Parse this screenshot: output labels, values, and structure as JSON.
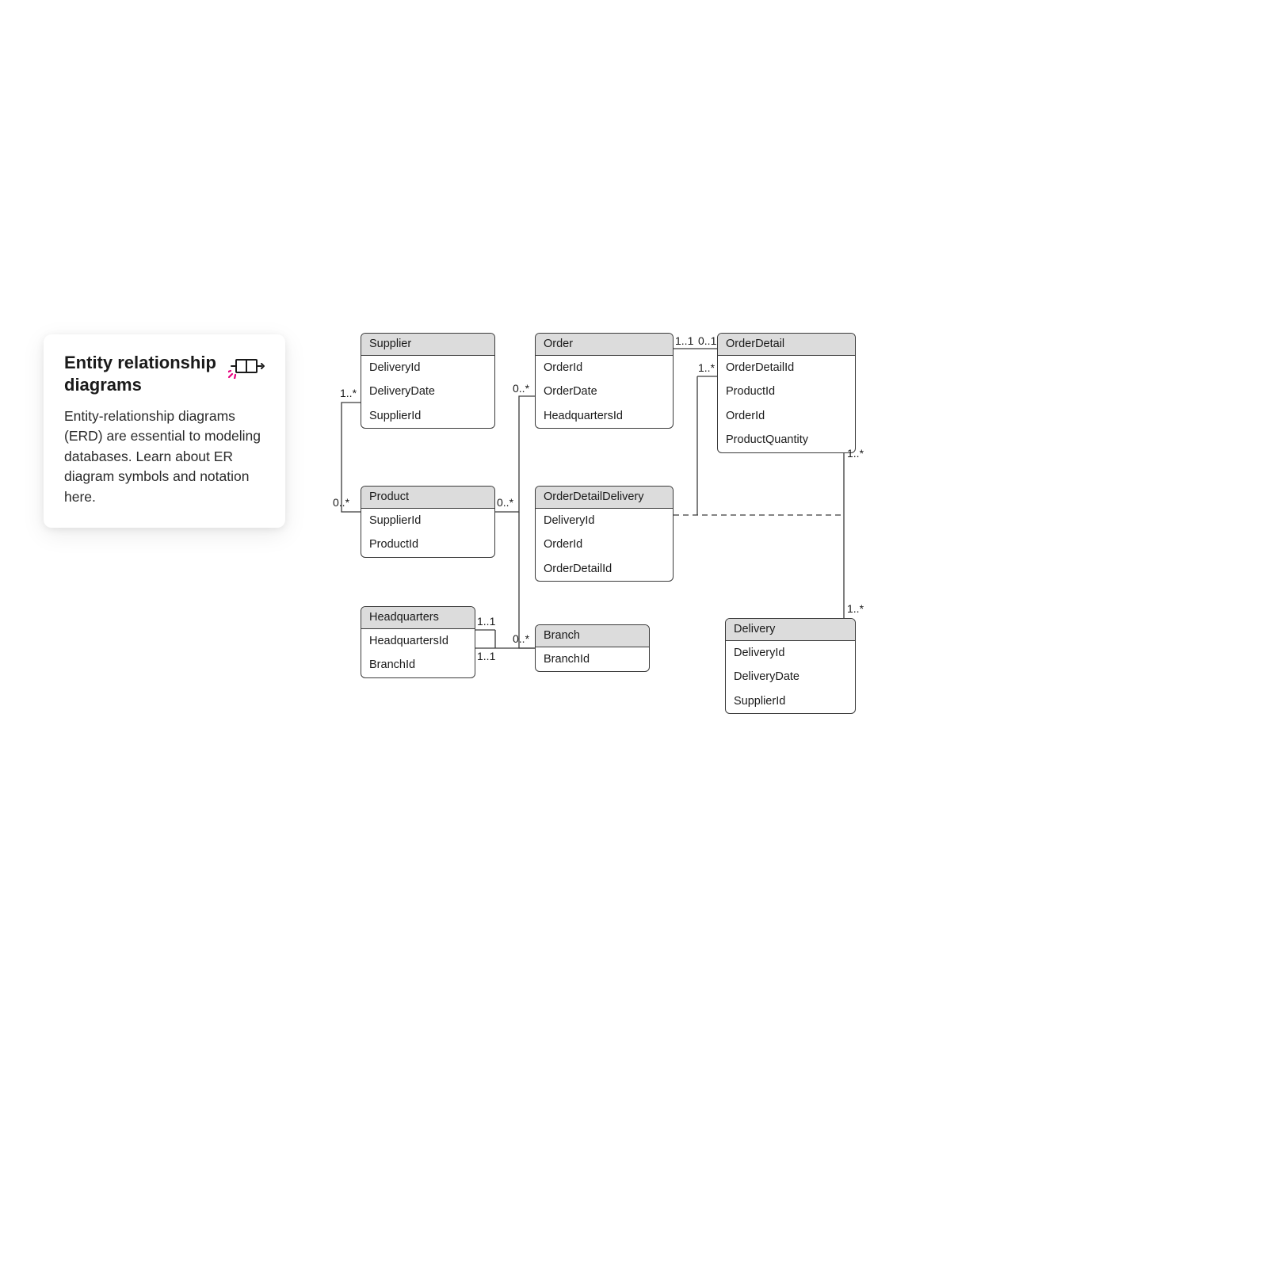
{
  "card": {
    "title": "Entity relationship diagrams",
    "body": "Entity-relationship diagrams (ERD) are essential to modeling databases. Learn about ER diagram symbols and notation here."
  },
  "entities": {
    "supplier": {
      "name": "Supplier",
      "attrs": [
        "DeliveryId",
        "DeliveryDate",
        "SupplierId"
      ]
    },
    "order": {
      "name": "Order",
      "attrs": [
        "OrderId",
        "OrderDate",
        "HeadquartersId"
      ]
    },
    "orderDetail": {
      "name": "OrderDetail",
      "attrs": [
        "OrderDetailId",
        "ProductId",
        "OrderId",
        "ProductQuantity"
      ]
    },
    "product": {
      "name": "Product",
      "attrs": [
        "SupplierId",
        "ProductId"
      ]
    },
    "odd": {
      "name": "OrderDetailDelivery",
      "attrs": [
        "DeliveryId",
        "OrderId",
        "OrderDetailId"
      ]
    },
    "hq": {
      "name": "Headquarters",
      "attrs": [
        "HeadquartersId",
        "BranchId"
      ]
    },
    "branch": {
      "name": "Branch",
      "attrs": [
        "BranchId"
      ]
    },
    "delivery": {
      "name": "Delivery",
      "attrs": [
        "DeliveryId",
        "DeliveryDate",
        "SupplierId"
      ]
    }
  },
  "mult": {
    "supplier_product": "1..*",
    "product_supplier": "0..*",
    "product_order": "0..*",
    "order_product": "0..*",
    "order_detail_l": "1..1",
    "order_detail_r": "0..1",
    "detail_odd": "1..*",
    "detail_delivery": "1..*",
    "delivery_detail": "1..*",
    "hq_order": "1..1",
    "hq_branch": "1..1",
    "branch_hq": "0..*"
  }
}
